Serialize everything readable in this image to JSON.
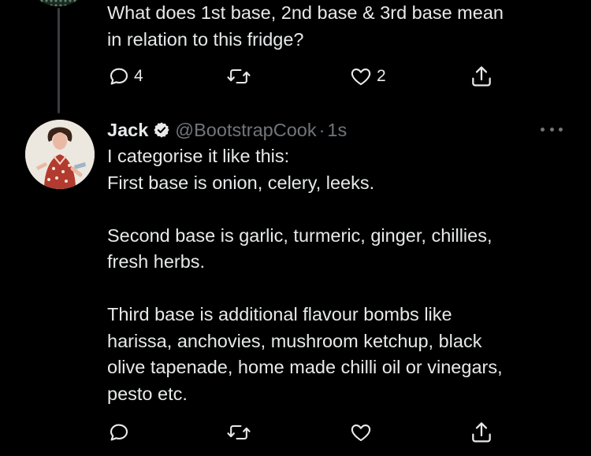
{
  "quoted_tweet": {
    "text": "What does 1st base, 2nd base & 3rd base mean\nin relation to this fridge?",
    "actions": {
      "reply_count": "4",
      "retweet_count": "",
      "like_count": "2",
      "reply_icon": "reply-icon",
      "retweet_icon": "retweet-icon",
      "like_icon": "heart-icon",
      "share_icon": "share-icon"
    }
  },
  "reply_tweet": {
    "author_name": "Jack",
    "handle": "@BootstrapCook",
    "separator": "·",
    "time": "1s",
    "text": "I categorise it like this:\nFirst base is onion, celery, leeks.\n\nSecond base is garlic, turmeric, ginger, chillies,\nfresh herbs.\n\nThird base is additional flavour bombs like\nharissa, anchovies, mushroom ketchup, black\nolive tapenade, home made chilli oil or vinegars,\npesto etc.",
    "verified_icon": "verified-badge-icon",
    "more_icon": "more-options-icon",
    "actions": {
      "reply_count": "",
      "retweet_count": "",
      "like_count": "",
      "reply_icon": "reply-icon",
      "retweet_icon": "retweet-icon",
      "like_icon": "heart-icon",
      "share_icon": "share-icon"
    }
  },
  "colors": {
    "background": "#000000",
    "text": "#e7e9ea",
    "secondary_text": "#71767b",
    "thread_line": "#3a3d40"
  }
}
